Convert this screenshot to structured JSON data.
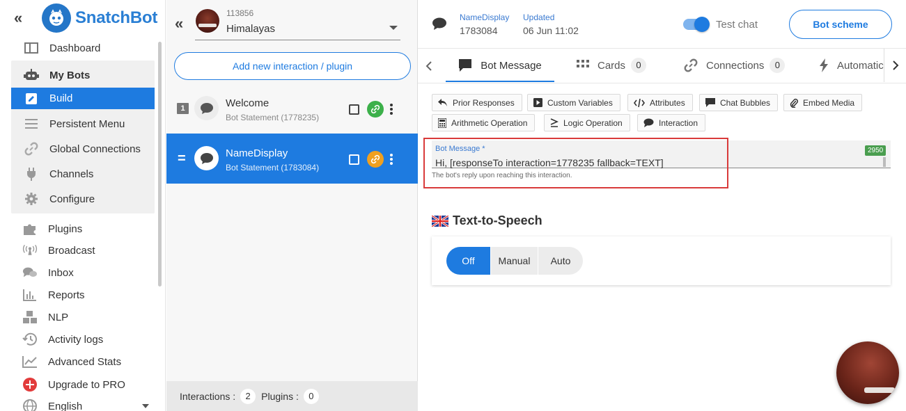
{
  "sidebar": {
    "collapse_glyph": "«",
    "logo_text": "SnatchBot",
    "items_top": [
      {
        "label": "Dashboard",
        "icon": "dashboard-icon"
      }
    ],
    "mybots": [
      {
        "label": "My Bots",
        "icon": "robot-icon"
      },
      {
        "label": "Build",
        "icon": "pencil-icon"
      },
      {
        "label": "Persistent Menu",
        "icon": "menu-lines-icon"
      },
      {
        "label": "Global Connections",
        "icon": "link-icon"
      },
      {
        "label": "Channels",
        "icon": "plug-icon"
      },
      {
        "label": "Configure",
        "icon": "gear-icon"
      }
    ],
    "items_bottom": [
      {
        "label": "Plugins",
        "icon": "puzzle-icon"
      },
      {
        "label": "Broadcast",
        "icon": "broadcast-icon"
      },
      {
        "label": "Inbox",
        "icon": "chat-icon"
      },
      {
        "label": "Reports",
        "icon": "bar-chart-icon"
      },
      {
        "label": "NLP",
        "icon": "cubes-icon"
      },
      {
        "label": "Activity logs",
        "icon": "history-icon"
      },
      {
        "label": "Advanced Stats",
        "icon": "line-chart-icon"
      },
      {
        "label": "Upgrade to PRO",
        "icon": "plus-circle-icon"
      },
      {
        "label": "English",
        "icon": "globe-icon"
      }
    ]
  },
  "middle": {
    "collapse_glyph": "«",
    "bot_id": "113856",
    "bot_name": "Himalayas",
    "add_button": "Add new interaction / plugin",
    "interactions": [
      {
        "num": "1",
        "title": "Welcome",
        "sub": "Bot Statement (1778235)",
        "link_color": "#3cb04a"
      },
      {
        "num": "=",
        "title": "NameDisplay",
        "sub": "Bot Statement (1783084)",
        "link_color": "#f0a020"
      }
    ],
    "footer": {
      "interactions_label": "Interactions :",
      "interactions_count": "2",
      "plugins_label": "Plugins :",
      "plugins_count": "0"
    }
  },
  "header": {
    "name_label": "NameDisplay",
    "id": "1783084",
    "updated_label": "Updated",
    "date": "06 Jun 11:02",
    "test_chat": "Test chat",
    "bot_scheme": "Bot scheme"
  },
  "tabs": [
    {
      "label": "Bot Message",
      "icon": "message-icon"
    },
    {
      "label": "Cards",
      "icon": "grid-icon",
      "count": "0"
    },
    {
      "label": "Connections",
      "icon": "link-icon",
      "count": "0"
    },
    {
      "label": "Automatic",
      "icon": "bolt-icon"
    }
  ],
  "chips": [
    {
      "label": "Prior Responses",
      "icon": "reply-icon"
    },
    {
      "label": "Custom Variables",
      "icon": "play-square-icon"
    },
    {
      "label": "Attributes",
      "icon": "code-icon"
    },
    {
      "label": "Chat Bubbles",
      "icon": "speech-icon"
    },
    {
      "label": "Embed Media",
      "icon": "paperclip-icon"
    },
    {
      "label": "Arithmetic Operation",
      "icon": "calculator-icon"
    },
    {
      "label": "Logic Operation",
      "icon": "sum-icon"
    },
    {
      "label": "Interaction",
      "icon": "chat-icon"
    }
  ],
  "message": {
    "label": "Bot Message *",
    "value": "Hi, [responseTo interaction=1778235 fallback=TEXT]",
    "count": "2950",
    "hint": "The bot's reply upon reaching this interaction."
  },
  "tts": {
    "title": "Text-to-Speech",
    "options": [
      "Off",
      "Manual",
      "Auto"
    ],
    "selected": "Off"
  },
  "colors": {
    "accent": "#1e7be0",
    "highlight": "#d93a3a"
  }
}
